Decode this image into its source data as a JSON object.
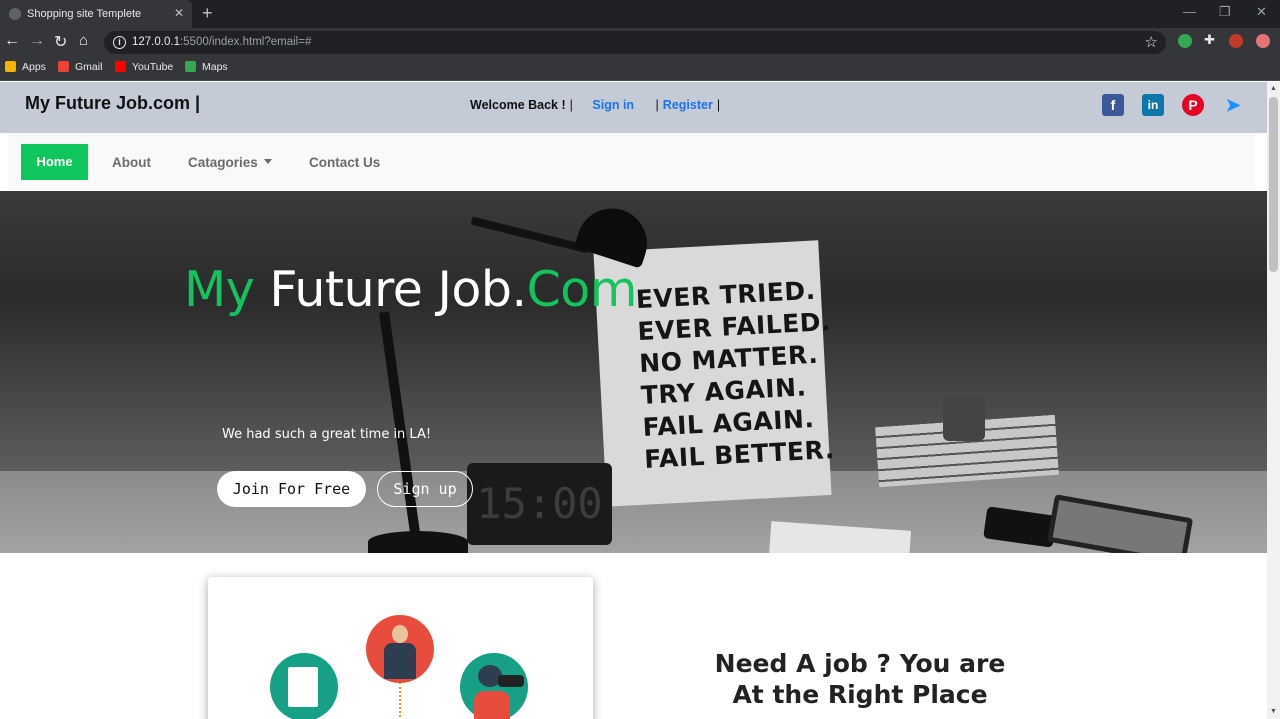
{
  "browser": {
    "tab_title": "Shopping site Templete",
    "url_host": "127.0.0.1",
    "url_rest": ":5500/index.html?email=#",
    "bookmarks": [
      {
        "label": "Apps",
        "icon": "apps-grid-icon",
        "color": "#f4b400"
      },
      {
        "label": "Gmail",
        "icon": "gmail-icon",
        "color": "#ea4335"
      },
      {
        "label": "YouTube",
        "icon": "youtube-icon",
        "color": "#ff0000"
      },
      {
        "label": "Maps",
        "icon": "maps-icon",
        "color": "#34a853"
      }
    ]
  },
  "header": {
    "brand": "My Future Job.com  |",
    "welcome": "Welcome Back !",
    "sign_in": "Sign in",
    "register": "Register",
    "social": [
      {
        "name": "facebook-icon",
        "color": "#3b5998"
      },
      {
        "name": "linkedin-icon",
        "color": "#0e76a8"
      },
      {
        "name": "pinterest-icon",
        "color": "#e60023"
      },
      {
        "name": "send-icon",
        "color": "#1e90ff"
      }
    ]
  },
  "nav": {
    "home": "Home",
    "about": "About",
    "categories": "Catagories",
    "contact": "Contact Us"
  },
  "hero": {
    "title_part1": "My",
    "title_part2": " Future Job.",
    "title_part3": "Com",
    "subtitle": "We had such a great time in LA!",
    "join_button": "Join For Free",
    "signup_button": "Sign up",
    "poster_lines": [
      "EVER TRIED.",
      "EVER FAILED.",
      "NO MATTER.",
      "TRY AGAIN.",
      "FAIL AGAIN.",
      "FAIL BETTER."
    ],
    "clock_text": "15:00",
    "accent": "#14c35e"
  },
  "section": {
    "heading_line1": "Need A job ? You are",
    "heading_line2": "At the Right Place"
  }
}
